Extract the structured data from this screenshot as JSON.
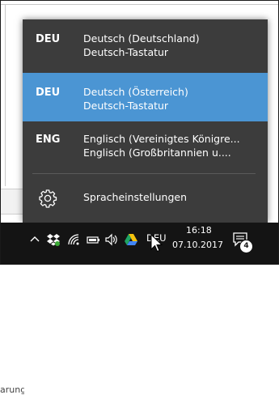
{
  "language_flyout": {
    "items": [
      {
        "code": "DEU",
        "name": "Deutsch (Deutschland)",
        "keyboard": "Deutsch-Tastatur",
        "selected": false
      },
      {
        "code": "DEU",
        "name": "Deutsch (Österreich)",
        "keyboard": "Deutsch-Tastatur",
        "selected": true
      },
      {
        "code": "ENG",
        "name": "Englisch (Vereinigtes Königre...",
        "keyboard": "Englisch (Großbritannien u....",
        "selected": false
      }
    ],
    "settings_label": "Spracheinstellungen",
    "settings_icon": "gear-icon"
  },
  "background_window": {
    "partial_text": "arung"
  },
  "taskbar": {
    "tray_icons": [
      "chevron-up-icon",
      "dropbox-icon",
      "wifi-icon",
      "battery-icon",
      "volume-icon",
      "google-drive-icon"
    ],
    "language_indicator": "DEU",
    "clock": {
      "time": "16:18",
      "date": "07.10.2017"
    },
    "notification_count": "4"
  },
  "colors": {
    "flyout_bg": "#3c3c3c",
    "selected_bg": "#4b95d3",
    "taskbar_bg": "#141414"
  }
}
